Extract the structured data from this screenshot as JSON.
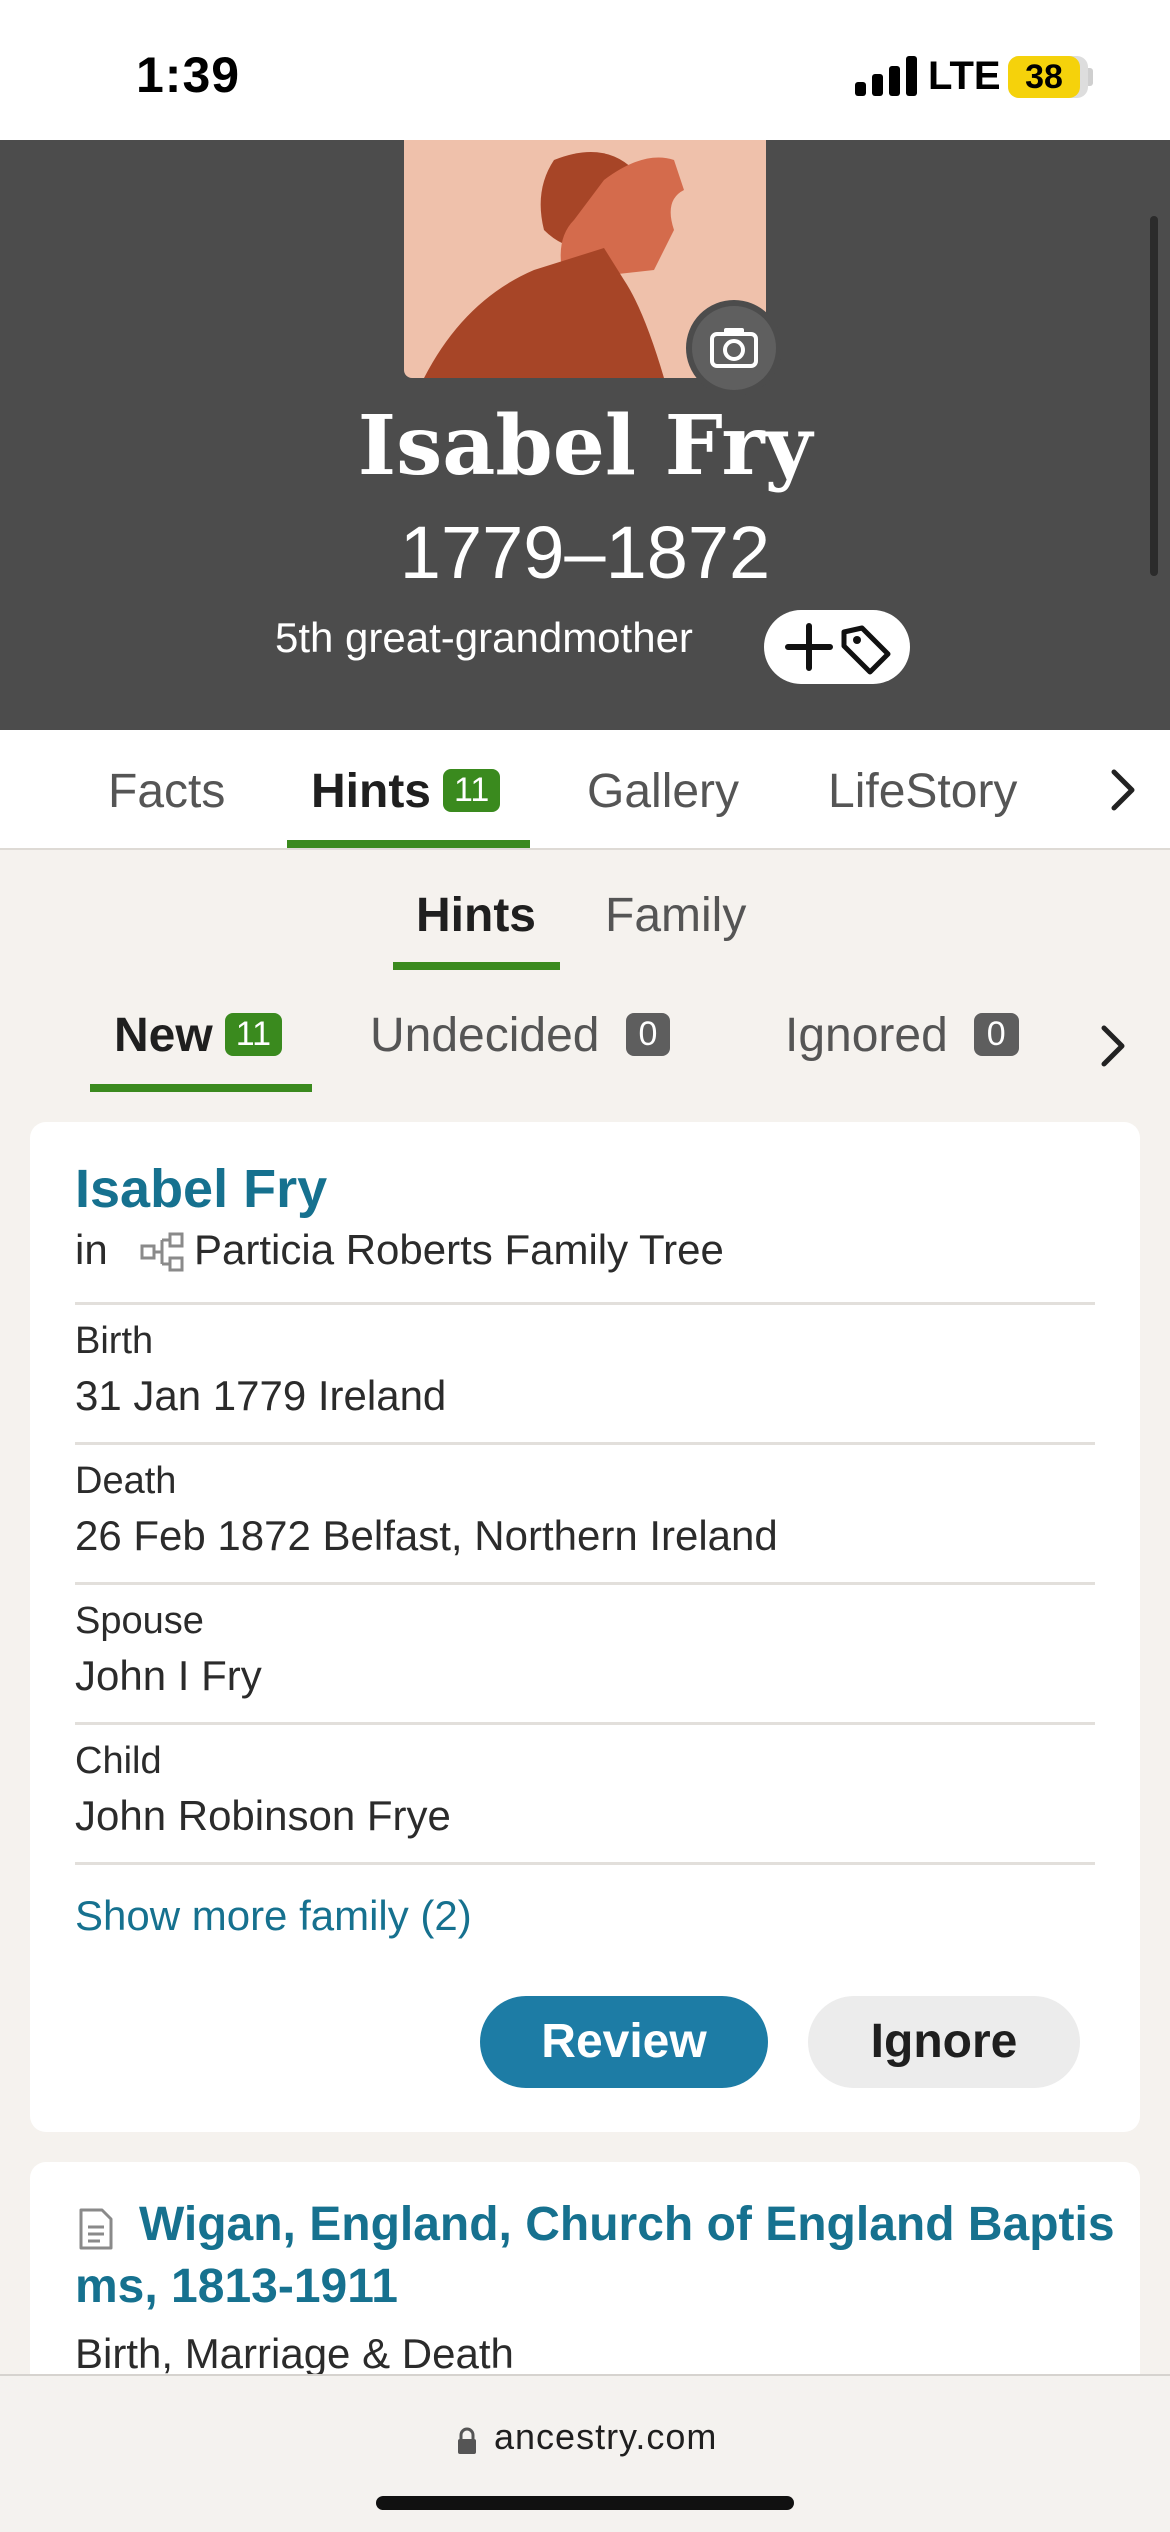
{
  "status_bar": {
    "time": "1:39",
    "network": "LTE",
    "battery": "38"
  },
  "profile": {
    "name": "Isabel Fry",
    "years": "1779–1872",
    "relation": "5th great-grandmother"
  },
  "main_tabs": [
    {
      "label": "Facts"
    },
    {
      "label": "Hints",
      "badge": "11"
    },
    {
      "label": "Gallery"
    },
    {
      "label": "LifeStory"
    }
  ],
  "sub_tabs": [
    {
      "label": "Hints"
    },
    {
      "label": "Family"
    }
  ],
  "status_tabs": [
    {
      "label": "New",
      "badge": "11"
    },
    {
      "label": "Undecided",
      "badge": "0"
    },
    {
      "label": "Ignored",
      "badge": "0"
    }
  ],
  "hint_card": {
    "title": "Isabel Fry",
    "in_label": "in",
    "tree_name": "Particia Roberts Family Tree",
    "fields": [
      {
        "label": "Birth",
        "value": "31 Jan 1779 Ireland"
      },
      {
        "label": "Death",
        "value": "26 Feb 1872 Belfast, Northern Ireland"
      },
      {
        "label": "Spouse",
        "value": "John I Fry"
      },
      {
        "label": "Child",
        "value": "John Robinson Frye"
      }
    ],
    "show_more": "Show more family (2)",
    "review_label": "Review",
    "ignore_label": "Ignore"
  },
  "record_card": {
    "title": "Wigan, England, Church of England Baptisms, 1813-1911",
    "subtitle": "Birth, Marriage & Death"
  },
  "browser": {
    "url": "ancestry.com"
  },
  "colors": {
    "accent_green": "#3a8a1e",
    "link_blue": "#16718f",
    "button_blue": "#1d7ca5",
    "hero_bg": "#4c4c4c"
  },
  "icons": [
    "camera-icon",
    "add-tag-icon",
    "chevron-right-icon",
    "family-tree-icon",
    "document-icon",
    "lock-icon"
  ]
}
